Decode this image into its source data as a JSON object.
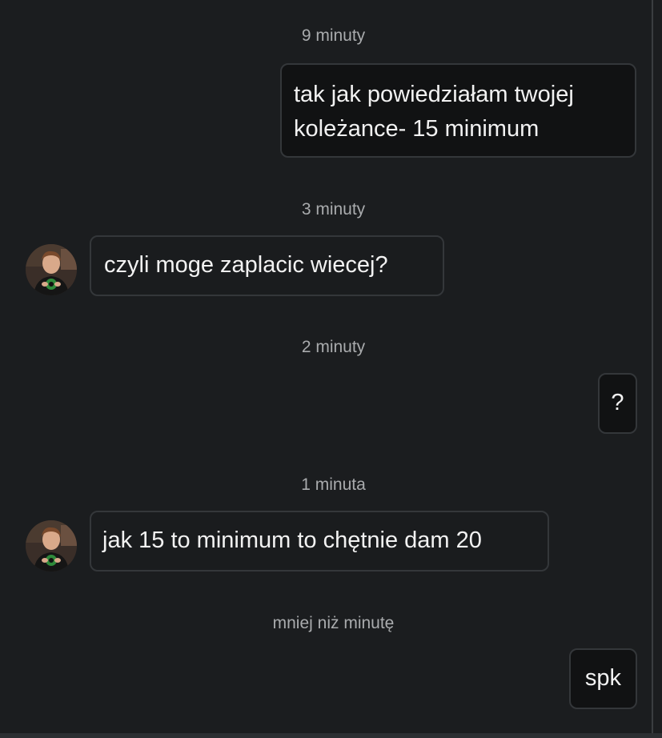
{
  "conversation": {
    "groups": [
      {
        "time": "9 minuty",
        "direction": "outgoing",
        "lines": [
          "tak jak powiedziałam twojej",
          "koleżance- 15 minimum"
        ]
      },
      {
        "time": "3 minuty",
        "direction": "incoming",
        "lines": [
          "czyli moge zaplacic wiecej?"
        ]
      },
      {
        "time": "2 minuty",
        "direction": "outgoing",
        "lines": [
          "?"
        ]
      },
      {
        "time": "1 minuta",
        "direction": "incoming",
        "lines": [
          "jak 15 to minimum to chętnie dam 20"
        ]
      },
      {
        "time": "mniej niż minutę",
        "direction": "outgoing",
        "lines": [
          "spk"
        ]
      }
    ]
  },
  "icons": {
    "avatar": "user-avatar-photo"
  },
  "colors": {
    "background": "#1b1d1f",
    "bubble_border": "#34373a",
    "timestamp_text": "#a9abad",
    "message_text": "#f2f2f2"
  }
}
